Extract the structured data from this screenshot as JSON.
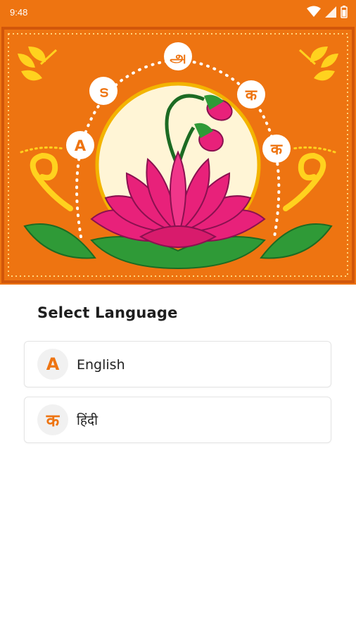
{
  "status_bar": {
    "time": "9:48"
  },
  "hero": {
    "script_letters": [
      "A",
      "ട",
      "அ",
      "क",
      "क"
    ],
    "colors": {
      "background": "#ee7411",
      "lotus": "#e8217a",
      "leaf": "#2f9a37",
      "moon": "#fff5d6"
    }
  },
  "main": {
    "title": "Select Language",
    "languages": [
      {
        "icon_letter": "A",
        "label": "English"
      },
      {
        "icon_letter": "क",
        "label": "हिंदी"
      }
    ]
  },
  "accent_color": "#ee7411"
}
